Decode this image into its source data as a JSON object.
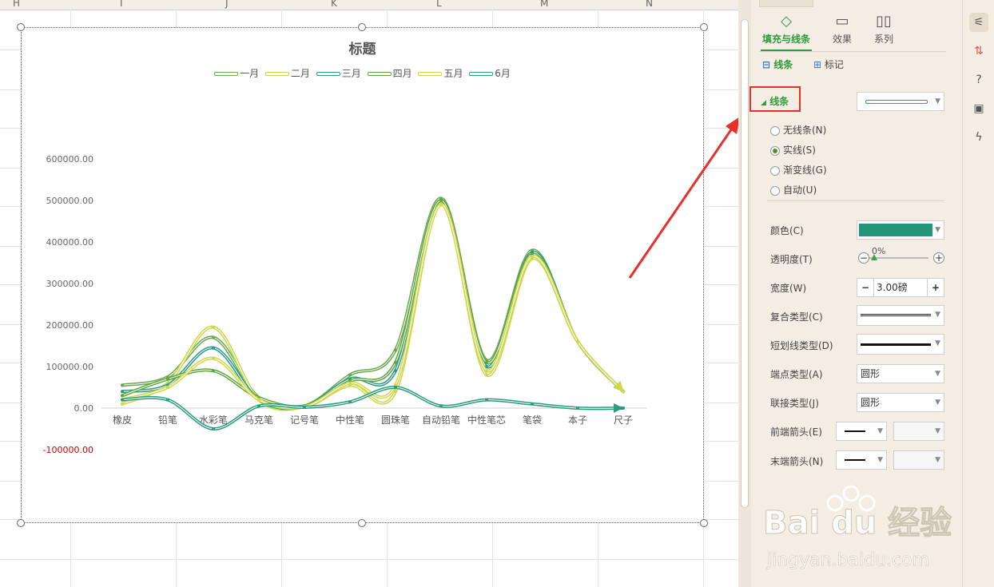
{
  "sheet": {
    "columns": [
      "H",
      "I",
      "J",
      "K",
      "L",
      "M",
      "N"
    ]
  },
  "chart": {
    "title": "标题",
    "legend": [
      {
        "name": "一月",
        "color": "#6aa84f"
      },
      {
        "name": "二月",
        "color": "#c9d84a"
      },
      {
        "name": "三月",
        "color": "#2e9a8a"
      },
      {
        "name": "四月",
        "color": "#5fa640"
      },
      {
        "name": "五月",
        "color": "#d2d64a"
      },
      {
        "name": "6月",
        "color": "#2a9d7f"
      }
    ],
    "ytick_labels": [
      "600000.00",
      "500000.00",
      "400000.00",
      "300000.00",
      "200000.00",
      "100000.00",
      "0.00",
      "-100000.00"
    ],
    "negative_tick_color": "#cc0000"
  },
  "chart_data": {
    "type": "line",
    "categories": [
      "橡皮",
      "铅笔",
      "水彩笔",
      "马克笔",
      "记号笔",
      "中性笔",
      "圆珠笔",
      "自动铅笔",
      "中性笔芯",
      "笔袋",
      "本子",
      "尺子"
    ],
    "ylim": [
      -100000,
      600000
    ],
    "series": [
      {
        "name": "一月",
        "values": [
          55000,
          75000,
          170000,
          25000,
          5000,
          80000,
          140000,
          505000,
          115000,
          380000,
          160000,
          40000
        ]
      },
      {
        "name": "二月",
        "values": [
          10000,
          60000,
          195000,
          20000,
          3000,
          55000,
          40000,
          495000,
          80000,
          360000,
          160000,
          40000
        ]
      },
      {
        "name": "三月",
        "values": [
          40000,
          55000,
          145000,
          20000,
          4000,
          70000,
          90000,
          500000,
          100000,
          375000,
          160000,
          40000
        ]
      },
      {
        "name": "四月",
        "values": [
          30000,
          70000,
          90000,
          25000,
          5000,
          65000,
          110000,
          500000,
          110000,
          370000,
          160000,
          40000
        ]
      },
      {
        "name": "五月",
        "values": [
          20000,
          50000,
          120000,
          20000,
          3000,
          60000,
          55000,
          490000,
          90000,
          365000,
          160000,
          40000
        ]
      },
      {
        "name": "6月",
        "values": [
          20000,
          20000,
          -50000,
          5000,
          2000,
          15000,
          50000,
          5000,
          20000,
          10000,
          0,
          0
        ]
      }
    ]
  },
  "panel": {
    "tabs": [
      {
        "label": "填充与线条",
        "icon": "paint-bucket-icon"
      },
      {
        "label": "效果",
        "icon": "effects-icon"
      },
      {
        "label": "系列",
        "icon": "series-icon"
      }
    ],
    "subtabs": [
      {
        "label": "线条",
        "icon": "line-icon"
      },
      {
        "label": "标记",
        "icon": "marker-icon"
      }
    ],
    "section_label": "线条",
    "radios": [
      {
        "label": "无线条(N)",
        "checked": false
      },
      {
        "label": "实线(S)",
        "checked": true
      },
      {
        "label": "渐变线(G)",
        "checked": false
      },
      {
        "label": "自动(U)",
        "checked": false
      }
    ],
    "color_label": "颜色(C)",
    "color_value": "#23967a",
    "transparency_label": "透明度(T)",
    "transparency_value": "0%",
    "width_label": "宽度(W)",
    "width_value": "3.00磅",
    "compound_label": "复合类型(C)",
    "dash_label": "短划线类型(D)",
    "cap_label": "端点类型(A)",
    "cap_value": "圆形",
    "join_label": "联接类型(J)",
    "join_value": "圆形",
    "begin_arrow_label": "前端箭头(E)",
    "end_arrow_label": "末端箭头(N)"
  }
}
